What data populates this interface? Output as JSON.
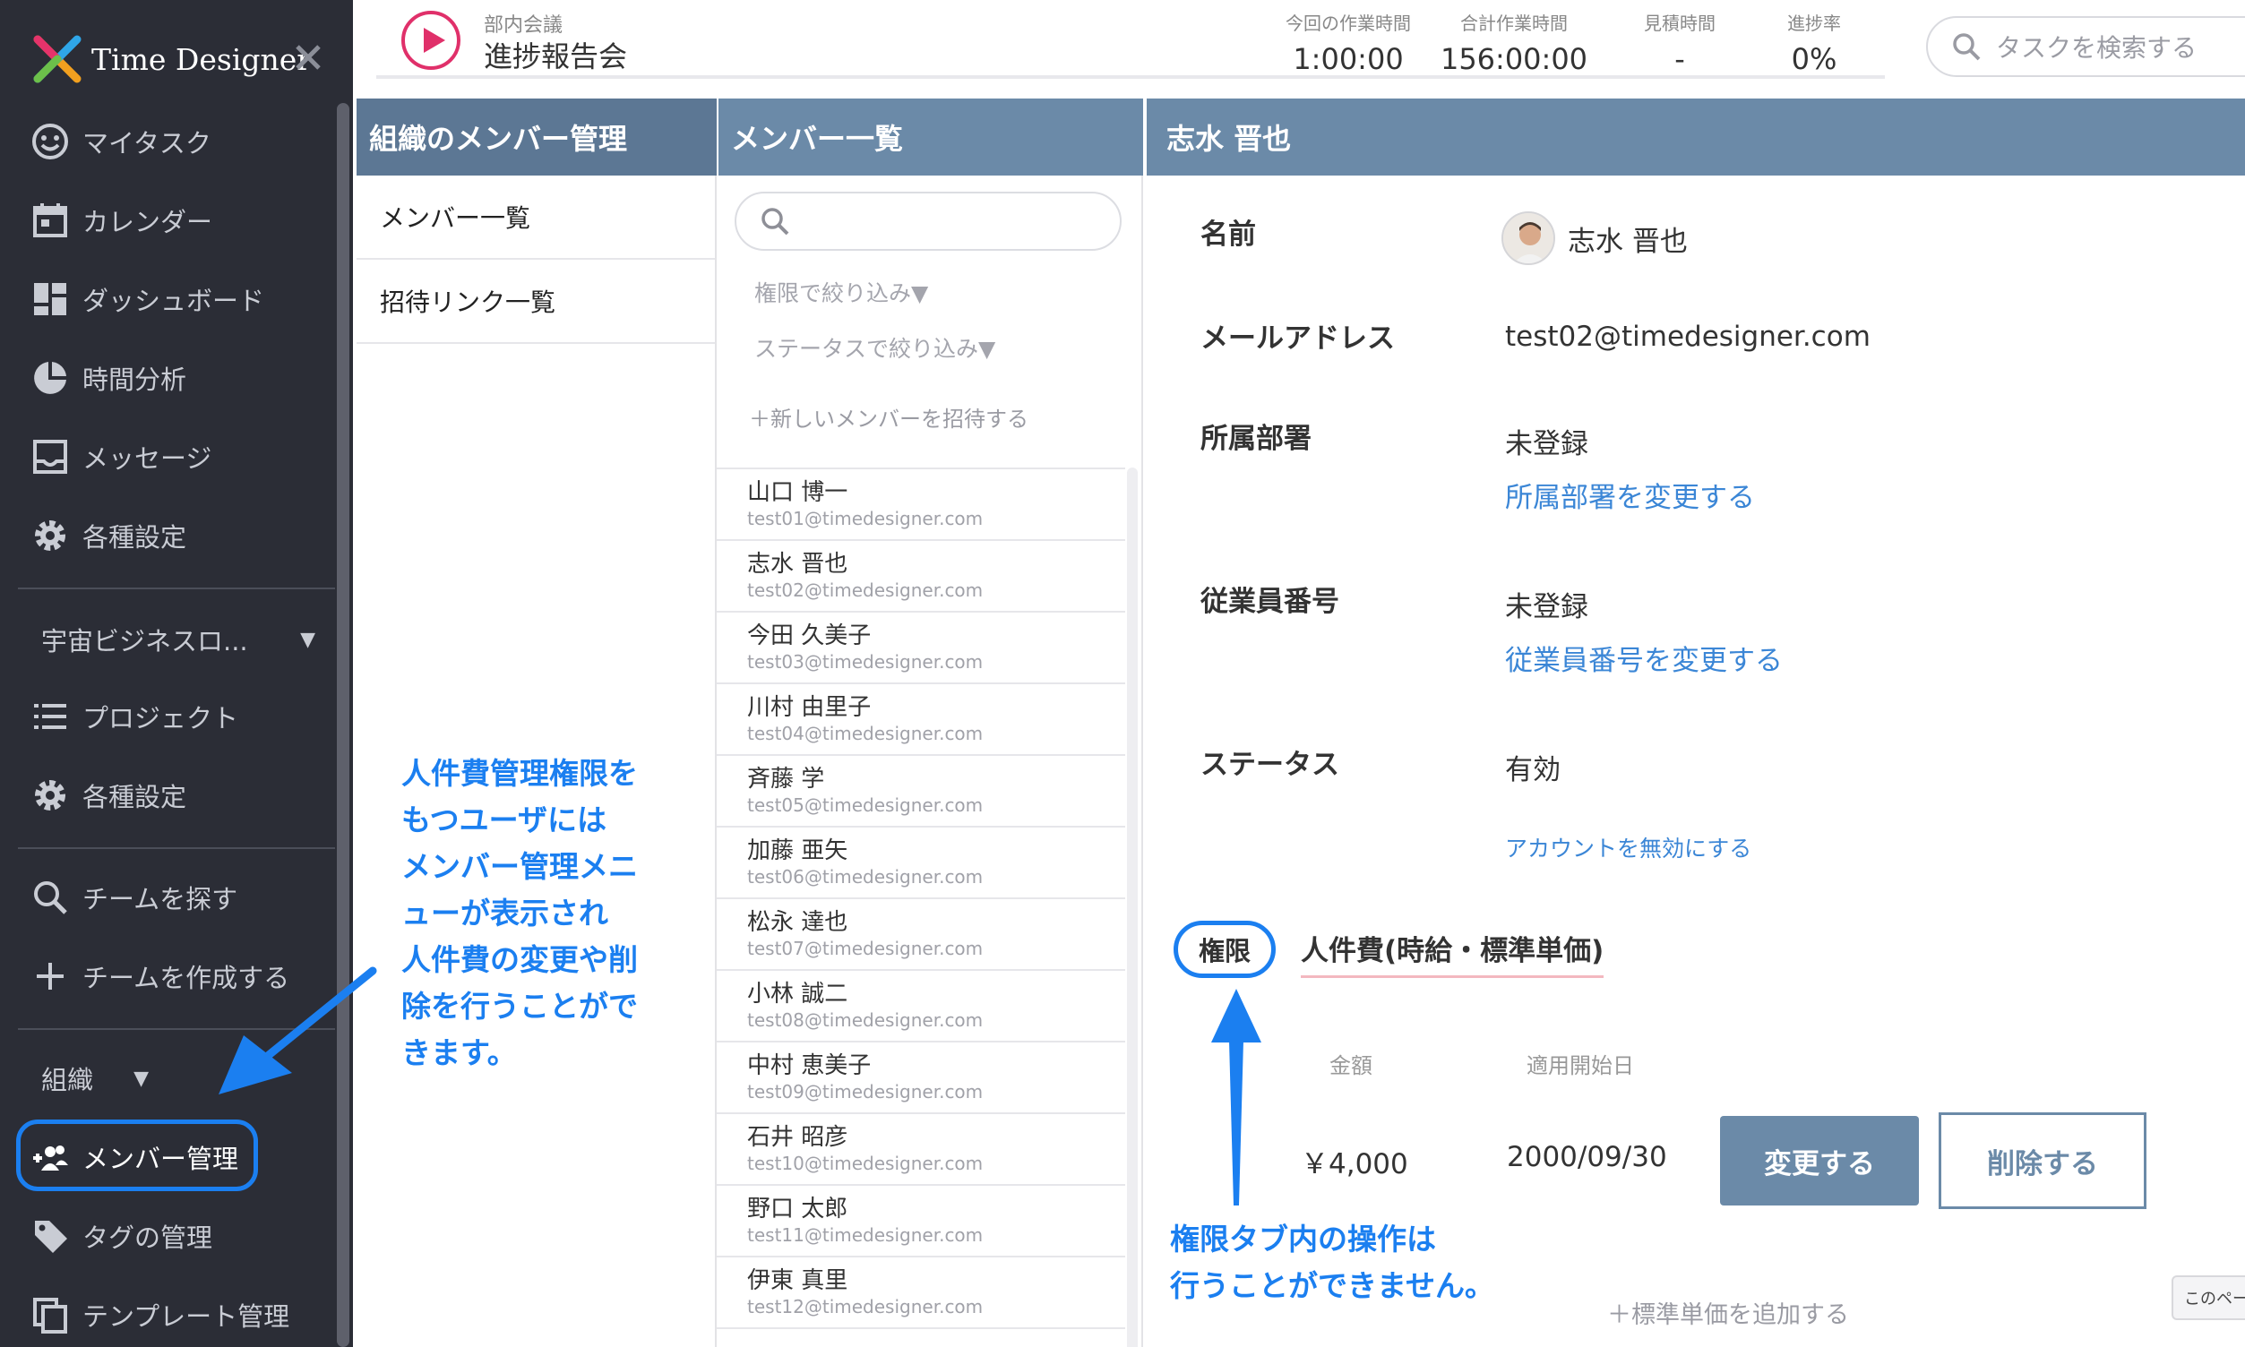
{
  "app": {
    "name": "Time Designer"
  },
  "sidebar": {
    "items": [
      {
        "label": "マイタスク",
        "icon": "smile-icon"
      },
      {
        "label": "カレンダー",
        "icon": "calendar-icon"
      },
      {
        "label": "ダッシュボード",
        "icon": "dashboard-icon"
      },
      {
        "label": "時間分析",
        "icon": "pie-chart-icon"
      },
      {
        "label": "メッセージ",
        "icon": "inbox-icon"
      },
      {
        "label": "各種設定",
        "icon": "gear-icon"
      }
    ],
    "workspace_select": "宇宙ビジネスロ...",
    "workspace_items": [
      {
        "label": "プロジェクト",
        "icon": "list-icon"
      },
      {
        "label": "各種設定",
        "icon": "gear-icon"
      }
    ],
    "team_items": [
      {
        "label": "チームを探す",
        "icon": "search-icon"
      },
      {
        "label": "チームを作成する",
        "icon": "plus-icon"
      }
    ],
    "org_select": "組織",
    "org_items": [
      {
        "label": "メンバー管理",
        "icon": "add-group-icon"
      },
      {
        "label": "タグの管理",
        "icon": "tag-icon"
      },
      {
        "label": "テンプレート管理",
        "icon": "copy-icon"
      }
    ]
  },
  "header": {
    "task_sub": "部内会議",
    "task_title": "進捗報告会",
    "stats": [
      {
        "label": "今回の作業時間",
        "value": "1:00:00"
      },
      {
        "label": "合計作業時間",
        "value": "156:00:00"
      },
      {
        "label": "見積時間",
        "value": "-"
      },
      {
        "label": "進捗率",
        "value": "0%"
      }
    ],
    "search_placeholder": "タスクを検索する"
  },
  "col1": {
    "title": "組織のメンバー管理",
    "items": [
      "メンバー一覧",
      "招待リンク一覧"
    ]
  },
  "col2": {
    "title": "メンバー一覧",
    "filter_role": "権限で絞り込み▼",
    "filter_status": "ステータスで絞り込み▼",
    "invite": "＋新しいメンバーを招待する",
    "members": [
      {
        "name": "山口 博一",
        "email": "test01@timedesigner.com"
      },
      {
        "name": "志水 晋也",
        "email": "test02@timedesigner.com"
      },
      {
        "name": "今田 久美子",
        "email": "test03@timedesigner.com"
      },
      {
        "name": "川村 由里子",
        "email": "test04@timedesigner.com"
      },
      {
        "name": "斉藤 学",
        "email": "test05@timedesigner.com"
      },
      {
        "name": "加藤 亜矢",
        "email": "test06@timedesigner.com"
      },
      {
        "name": "松永 達也",
        "email": "test07@timedesigner.com"
      },
      {
        "name": "小林 誠二",
        "email": "test08@timedesigner.com"
      },
      {
        "name": "中村 恵美子",
        "email": "test09@timedesigner.com"
      },
      {
        "name": "石井 昭彦",
        "email": "test10@timedesigner.com"
      },
      {
        "name": "野口 太郎",
        "email": "test11@timedesigner.com"
      },
      {
        "name": "伊東 真里",
        "email": "test12@timedesigner.com"
      }
    ]
  },
  "detail": {
    "title": "志水 晋也",
    "name_label": "名前",
    "name_value": "志水 晋也",
    "email_label": "メールアドレス",
    "email_value": "test02@timedesigner.com",
    "dept_label": "所属部署",
    "dept_value": "未登録",
    "dept_link": "所属部署を変更する",
    "empno_label": "従業員番号",
    "empno_value": "未登録",
    "empno_link": "従業員番号を変更する",
    "status_label": "ステータス",
    "status_value": "有効",
    "deactivate_link": "アカウントを無効にする",
    "tab_permission": "権限",
    "tab_cost": "人件費(時給・標準単価)",
    "cost_headers": [
      "金額",
      "適用開始日"
    ],
    "cost_amount": "￥4,000",
    "cost_date": "2000/09/30",
    "change_button": "変更する",
    "delete_button": "削除する",
    "add_unit": "＋標準単価を追加する",
    "page_tip": "このペー"
  },
  "annotations": {
    "left_lines": [
      "人件費管理権限を",
      "もつユーザには",
      "メンバー管理メニ",
      "ューが表示され",
      "人件費の変更や削",
      "除を行うことがで",
      "きます。"
    ],
    "bottom_lines": [
      "権限タブ内の操作は",
      "行うことができません。"
    ]
  },
  "colors": {
    "accent": "#1b7ff0",
    "header_bar": "#6b8aa8",
    "sidebar_bg": "#2b2d36",
    "link": "#3b86d6",
    "play": "#e0306a"
  }
}
